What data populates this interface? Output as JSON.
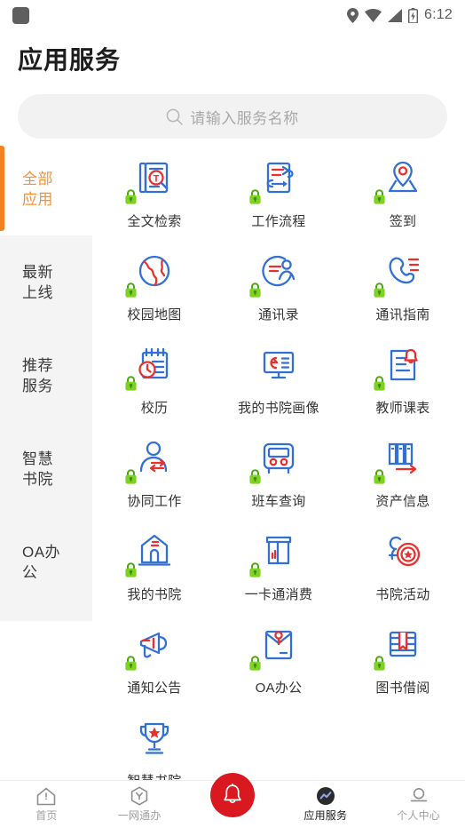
{
  "status_bar": {
    "left_icon": "rounded-square-notification",
    "icons": [
      "location-pin-icon",
      "wifi-icon",
      "signal-icon",
      "battery-charging-icon"
    ],
    "time": "6:12"
  },
  "header": {
    "title": "应用服务"
  },
  "search": {
    "icon": "search-icon",
    "placeholder": "请输入服务名称",
    "value": ""
  },
  "sidebar": {
    "active_color": "#f58220",
    "items": [
      {
        "label": "全部应用",
        "line1": "全部",
        "line2": "应用",
        "active": true
      },
      {
        "label": "最新上线",
        "line1": "最新",
        "line2": "上线",
        "active": false
      },
      {
        "label": "推荐服务",
        "line1": "推荐",
        "line2": "服务",
        "active": false
      },
      {
        "label": "智慧书院",
        "line1": "智慧",
        "line2": "书院",
        "active": false
      },
      {
        "label": "OA办公",
        "line1": "OA办",
        "line2": "公",
        "active": false
      }
    ]
  },
  "apps": [
    {
      "label": "全文检索",
      "icon": "document-search-icon",
      "locked": true
    },
    {
      "label": "工作流程",
      "icon": "workflow-icon",
      "locked": true
    },
    {
      "label": "签到",
      "icon": "location-checkin-icon",
      "locked": true
    },
    {
      "label": "校园地图",
      "icon": "globe-map-icon",
      "locked": true
    },
    {
      "label": "通讯录",
      "icon": "contacts-icon",
      "locked": true
    },
    {
      "label": "通讯指南",
      "icon": "phone-guide-icon",
      "locked": true
    },
    {
      "label": "校历",
      "icon": "calendar-clock-icon",
      "locked": true
    },
    {
      "label": "我的书院画像",
      "icon": "monitor-profile-icon",
      "locked": false
    },
    {
      "label": "教师课表",
      "icon": "schedule-bell-icon",
      "locked": true
    },
    {
      "label": "协同工作",
      "icon": "people-exchange-icon",
      "locked": true
    },
    {
      "label": "班车查询",
      "icon": "bus-icon",
      "locked": true
    },
    {
      "label": "资产信息",
      "icon": "assets-arrow-icon",
      "locked": true
    },
    {
      "label": "我的书院",
      "icon": "building-icon",
      "locked": true
    },
    {
      "label": "一卡通消费",
      "icon": "card-terminal-icon",
      "locked": true
    },
    {
      "label": "书院活动",
      "icon": "activity-badge-icon",
      "locked": false
    },
    {
      "label": "通知公告",
      "icon": "megaphone-icon",
      "locked": true
    },
    {
      "label": "OA办公",
      "icon": "envelope-key-icon",
      "locked": true
    },
    {
      "label": "图书借阅",
      "icon": "book-bookmark-icon",
      "locked": true
    },
    {
      "label": "智慧书院",
      "icon": "trophy-icon",
      "locked": false
    }
  ],
  "bottom_nav": {
    "items": [
      {
        "label": "首页",
        "icon": "home-icon",
        "active": false
      },
      {
        "label": "一网通办",
        "icon": "hexagon-service-icon",
        "active": false
      },
      {
        "label": "应用服务",
        "icon": "chart-circle-icon",
        "active": true
      },
      {
        "label": "个人中心",
        "icon": "person-icon",
        "active": false
      }
    ],
    "fab": {
      "icon": "bell-icon",
      "color": "#d9181f"
    }
  }
}
